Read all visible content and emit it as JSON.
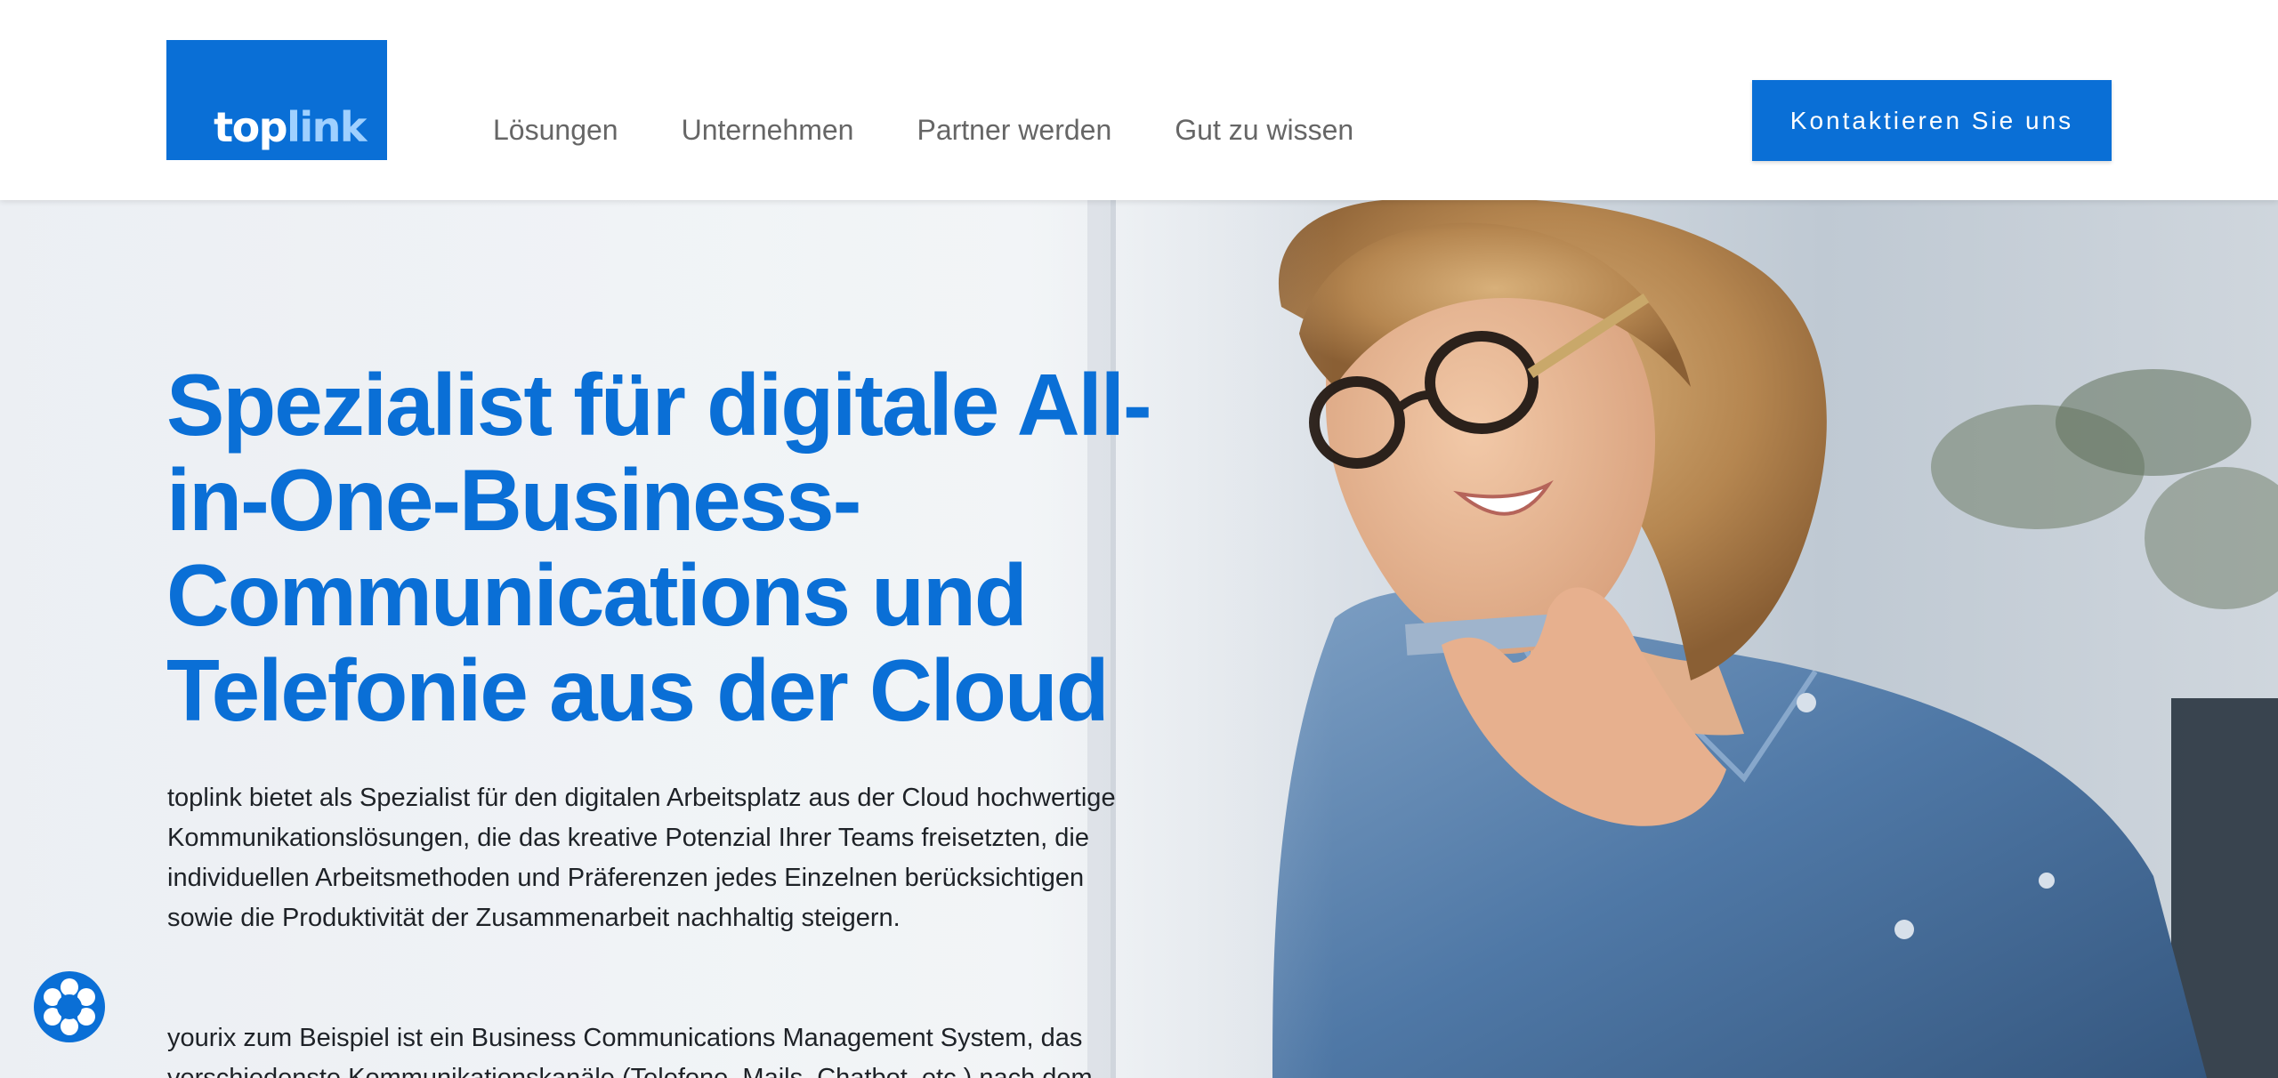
{
  "header": {
    "logo": {
      "part1": "top",
      "part2": "link"
    },
    "nav": [
      {
        "label": "Lösungen"
      },
      {
        "label": "Unternehmen"
      },
      {
        "label": "Partner werden"
      },
      {
        "label": "Gut zu wissen"
      }
    ],
    "cta_label": "Kontaktieren Sie uns"
  },
  "hero": {
    "title": "Spezialist für digitale All-in-One-Business-Communications und Telefonie aus der Cloud",
    "paragraph1": "toplink bietet als Spezialist für den digitalen Arbeitsplatz aus der Cloud hochwertige Kommunikationslösungen, die das kreative Potenzial Ihrer Teams freisetzten, die individuellen Arbeitsmethoden und Präferenzen jedes Einzelnen berücksichtigen sowie die Produktivität der Zusammenarbeit nachhaltig steigern.",
    "paragraph2": "yourix zum Beispiel ist ein Business Communications Management System, das verschiedenste Kommunikationskanäle (Telefone, Mails, Chatbot, etc.) nach dem"
  },
  "cookie_button": {
    "icon": "cookie-settings-icon"
  },
  "colors": {
    "brand": "#0a6fd6",
    "logo_link": "#9fd0ff",
    "nav_text": "#666666",
    "body_text": "#1e2227"
  }
}
